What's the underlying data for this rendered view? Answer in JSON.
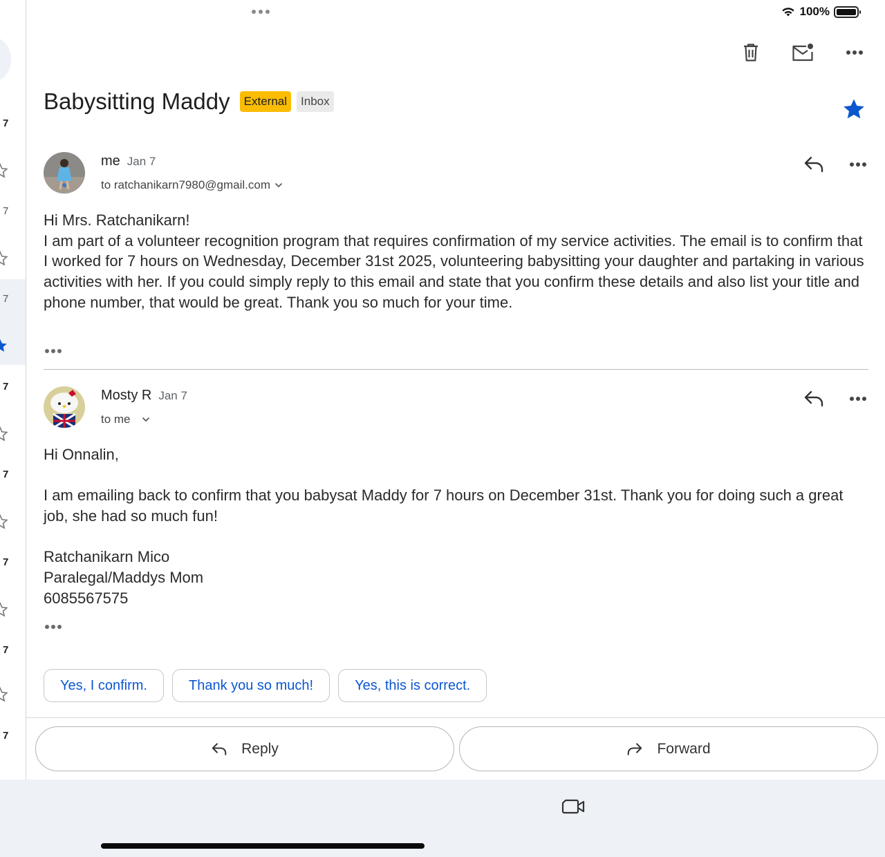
{
  "status_bar": {
    "battery": "100%"
  },
  "left_list": {
    "rows": [
      "7",
      "7",
      "7",
      "7",
      "7",
      "7",
      "7",
      "7"
    ]
  },
  "toolbar": {
    "icons": [
      "trash-icon",
      "mark-unread-icon",
      "more-icon"
    ]
  },
  "thread": {
    "subject": "Babysitting Maddy",
    "labels": {
      "external": "External",
      "inbox": "Inbox"
    },
    "starred": true,
    "accent_color": "#0b57d0",
    "external_color": "#fbbc04"
  },
  "messages": [
    {
      "sender": "me",
      "date": "Jan 7",
      "recipient": "to ratchanikarn7980@gmail.com",
      "body": [
        "Hi Mrs. Ratchanikarn!",
        "I am part of a volunteer recognition program that requires confirmation of my service activities. The email is to confirm that I worked for 7 hours on Wednesday, December 31st 2025, volunteering babysitting your daughter and partaking in various activities with her. If you could simply reply to this email and state that you confirm these details and also list your title and phone number, that would be great. Thank you so much for your time."
      ]
    },
    {
      "sender": "Mosty R",
      "date": "Jan 7",
      "recipient": "to me",
      "body": [
        "Hi Onnalin,",
        "",
        "I am emailing back to confirm that you babysat Maddy for 7 hours on December 31st. Thank you for doing such a great job, she had so much fun!",
        "",
        "Ratchanikarn Mico",
        "Paralegal/Maddys Mom",
        "6085567575"
      ]
    }
  ],
  "smart_replies": [
    "Yes, I confirm.",
    "Thank you so much!",
    "Yes, this is correct."
  ],
  "actions": {
    "reply": "Reply",
    "forward": "Forward"
  }
}
